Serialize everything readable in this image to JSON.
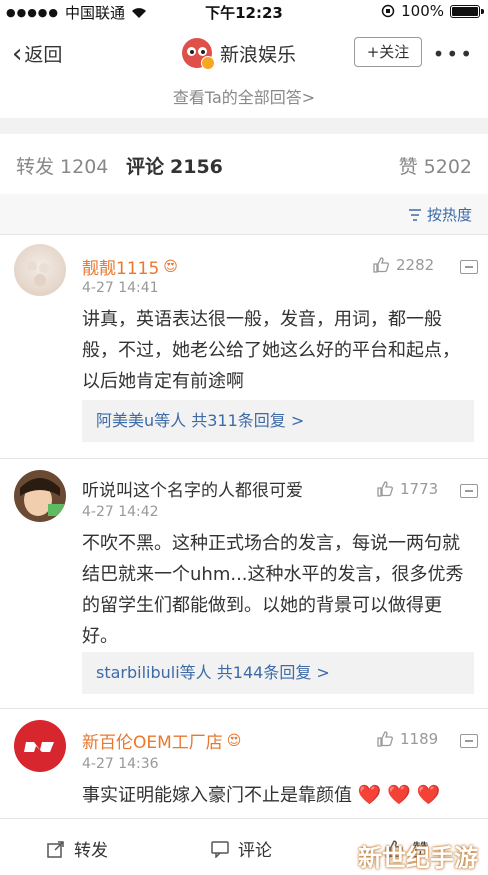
{
  "status_bar": {
    "carrier": "中国联通",
    "time": "下午12:23",
    "battery": "100%",
    "battery_level": 1.0
  },
  "nav": {
    "back_label": "返回",
    "title": "新浪娱乐",
    "follow_label": "+关注",
    "more_label": "•••"
  },
  "view_all": "查看Ta的全部回答>",
  "tabs": [
    {
      "label": "转发",
      "count": "1204"
    },
    {
      "label": "评论",
      "count": "2156"
    },
    {
      "label": "赞",
      "count": "5202"
    }
  ],
  "sort_label": "按热度",
  "comments": [
    {
      "name": "靓靓1115",
      "time": "4-27 14:41",
      "likes": "2282",
      "text": "讲真，英语表达很一般，发音，用词，都一般般，不过，她老公给了她这么好的平台和起点，以后她肯定有前途啊",
      "reply_users": "阿美美u等人",
      "reply_count": "共311条回复 >"
    },
    {
      "name": "听说叫这个名字的人都很可爱",
      "time": "4-27 14:42",
      "likes": "1773",
      "text": "不吹不黑。这种正式场合的发言，每说一两句就结巴就来一个uhm...这种水平的发言，很多优秀的留学生们都能做到。以她的背景可以做得更好。",
      "reply_users": "starbilibuli等人",
      "reply_count": "共144条回复 >"
    },
    {
      "name": "新百伦OEM工厂店",
      "time": "4-27 14:36",
      "likes": "1189",
      "text": "事实证明能嫁入豪门不止是靠颜值"
    }
  ],
  "bottom_bar": {
    "repost_label": "转发",
    "comment_label": "评论",
    "like_label": "赞"
  },
  "watermark": "新世纪手游",
  "colors": {
    "username": "#e9782f",
    "link": "#3d6aa8",
    "heart": "#e8342f"
  }
}
